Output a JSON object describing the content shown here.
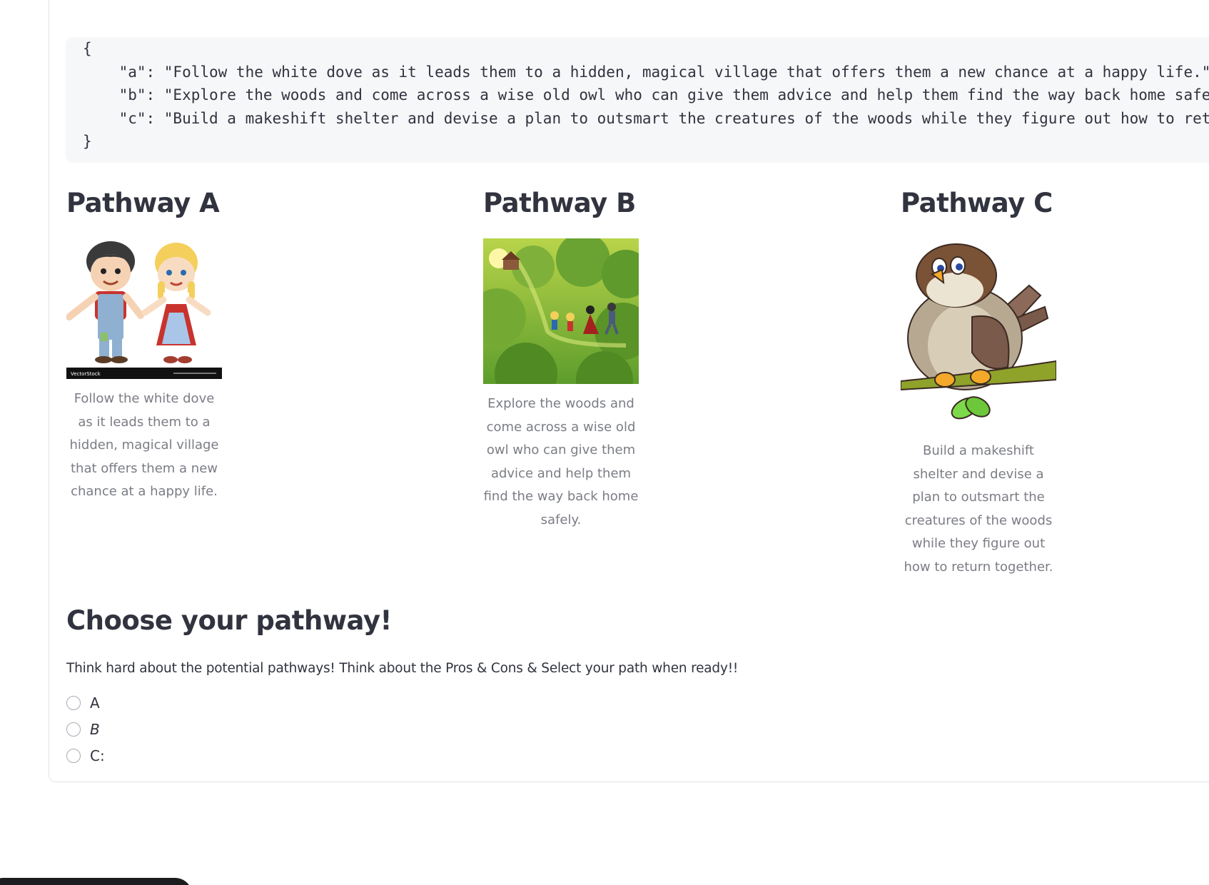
{
  "code_block": {
    "lines": [
      "{",
      "    \"a\": \"Follow the white dove as it leads them to a hidden, magical village that offers them a new chance at a happy life.\",",
      "    \"b\": \"Explore the woods and come across a wise old owl who can give them advice and help them find the way back home safely.\",",
      "    \"c\": \"Build a makeshift shelter and devise a plan to outsmart the creatures of the woods while they figure out how to return t",
      "}"
    ]
  },
  "pathways": [
    {
      "title": "Pathway A",
      "image": "hansel-and-gretel-children-icon",
      "image_watermark": "VectorStock",
      "caption": "Follow the white dove as it leads them to a hidden, magical village that offers them a new chance at a happy life."
    },
    {
      "title": "Pathway B",
      "image": "children-walking-through-forest-icon",
      "caption": "Explore the woods and come across a wise old owl who can give them advice and help them find the way back home safely."
    },
    {
      "title": "Pathway C",
      "image": "owl-on-branch-icon",
      "caption": "Build a makeshift shelter and devise a plan to outsmart the creatures of the woods while they figure out how to return together."
    }
  ],
  "choose": {
    "title": "Choose your pathway!",
    "instructions": "Think hard about the potential pathways! Think about the Pros & Cons & Select your path when ready!!",
    "options": [
      "A",
      "B",
      "C:"
    ]
  },
  "colors": {
    "text": "#31333f",
    "caption": "#7b7d85",
    "code_bg": "#f6f7f9",
    "border": "#e3e5ea"
  }
}
